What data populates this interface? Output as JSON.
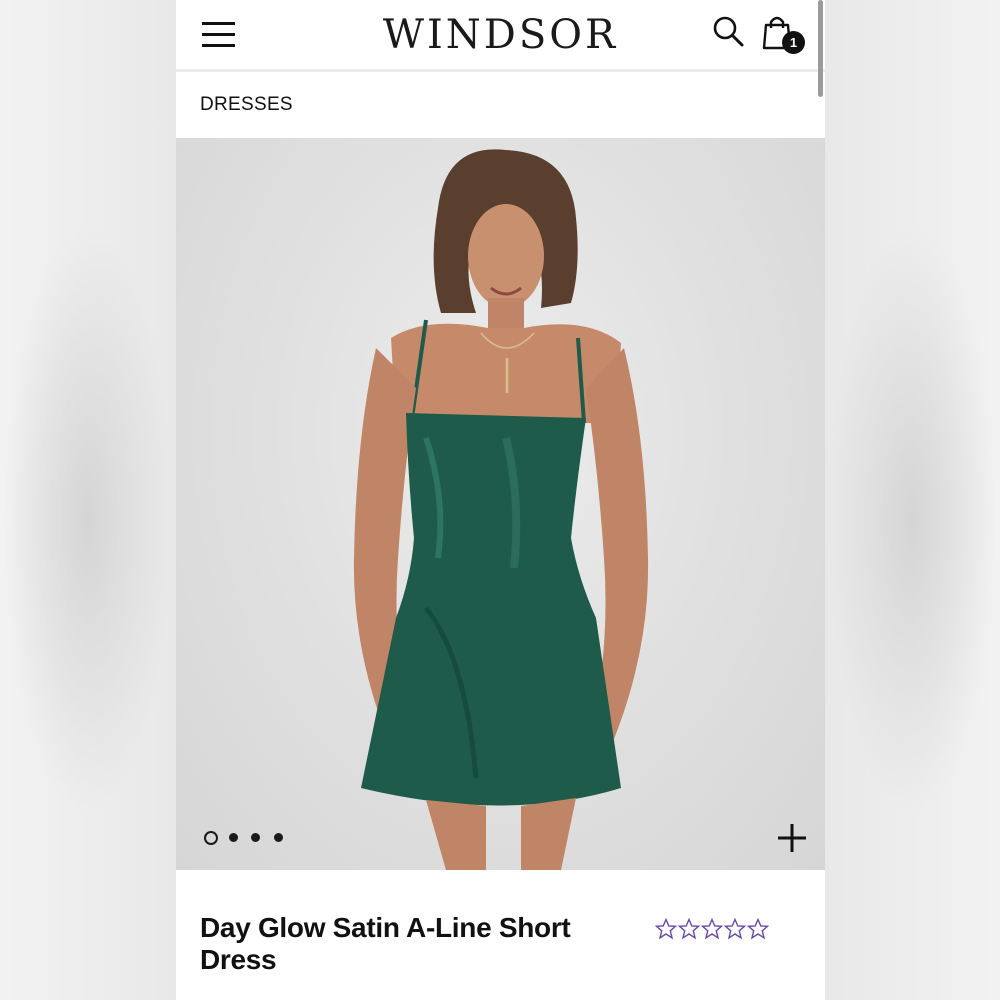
{
  "header": {
    "logo": "WINDSOR",
    "cart_count": "1",
    "icons": [
      "hamburger-menu-icon",
      "search-icon",
      "shopping-bag-icon"
    ]
  },
  "breadcrumb": {
    "label": "DRESSES"
  },
  "gallery": {
    "image": "model wearing green satin mini dress",
    "slide_count": 4,
    "active_slide": 1,
    "zoom_icon": "plus-icon"
  },
  "product": {
    "title": "Day Glow Satin A-Line Short Dress",
    "rating_stars": 5,
    "rating_filled": 0
  },
  "colors": {
    "dress": "#1e5b4a",
    "star_outline": "#6b46a8",
    "accent": "#111111"
  }
}
